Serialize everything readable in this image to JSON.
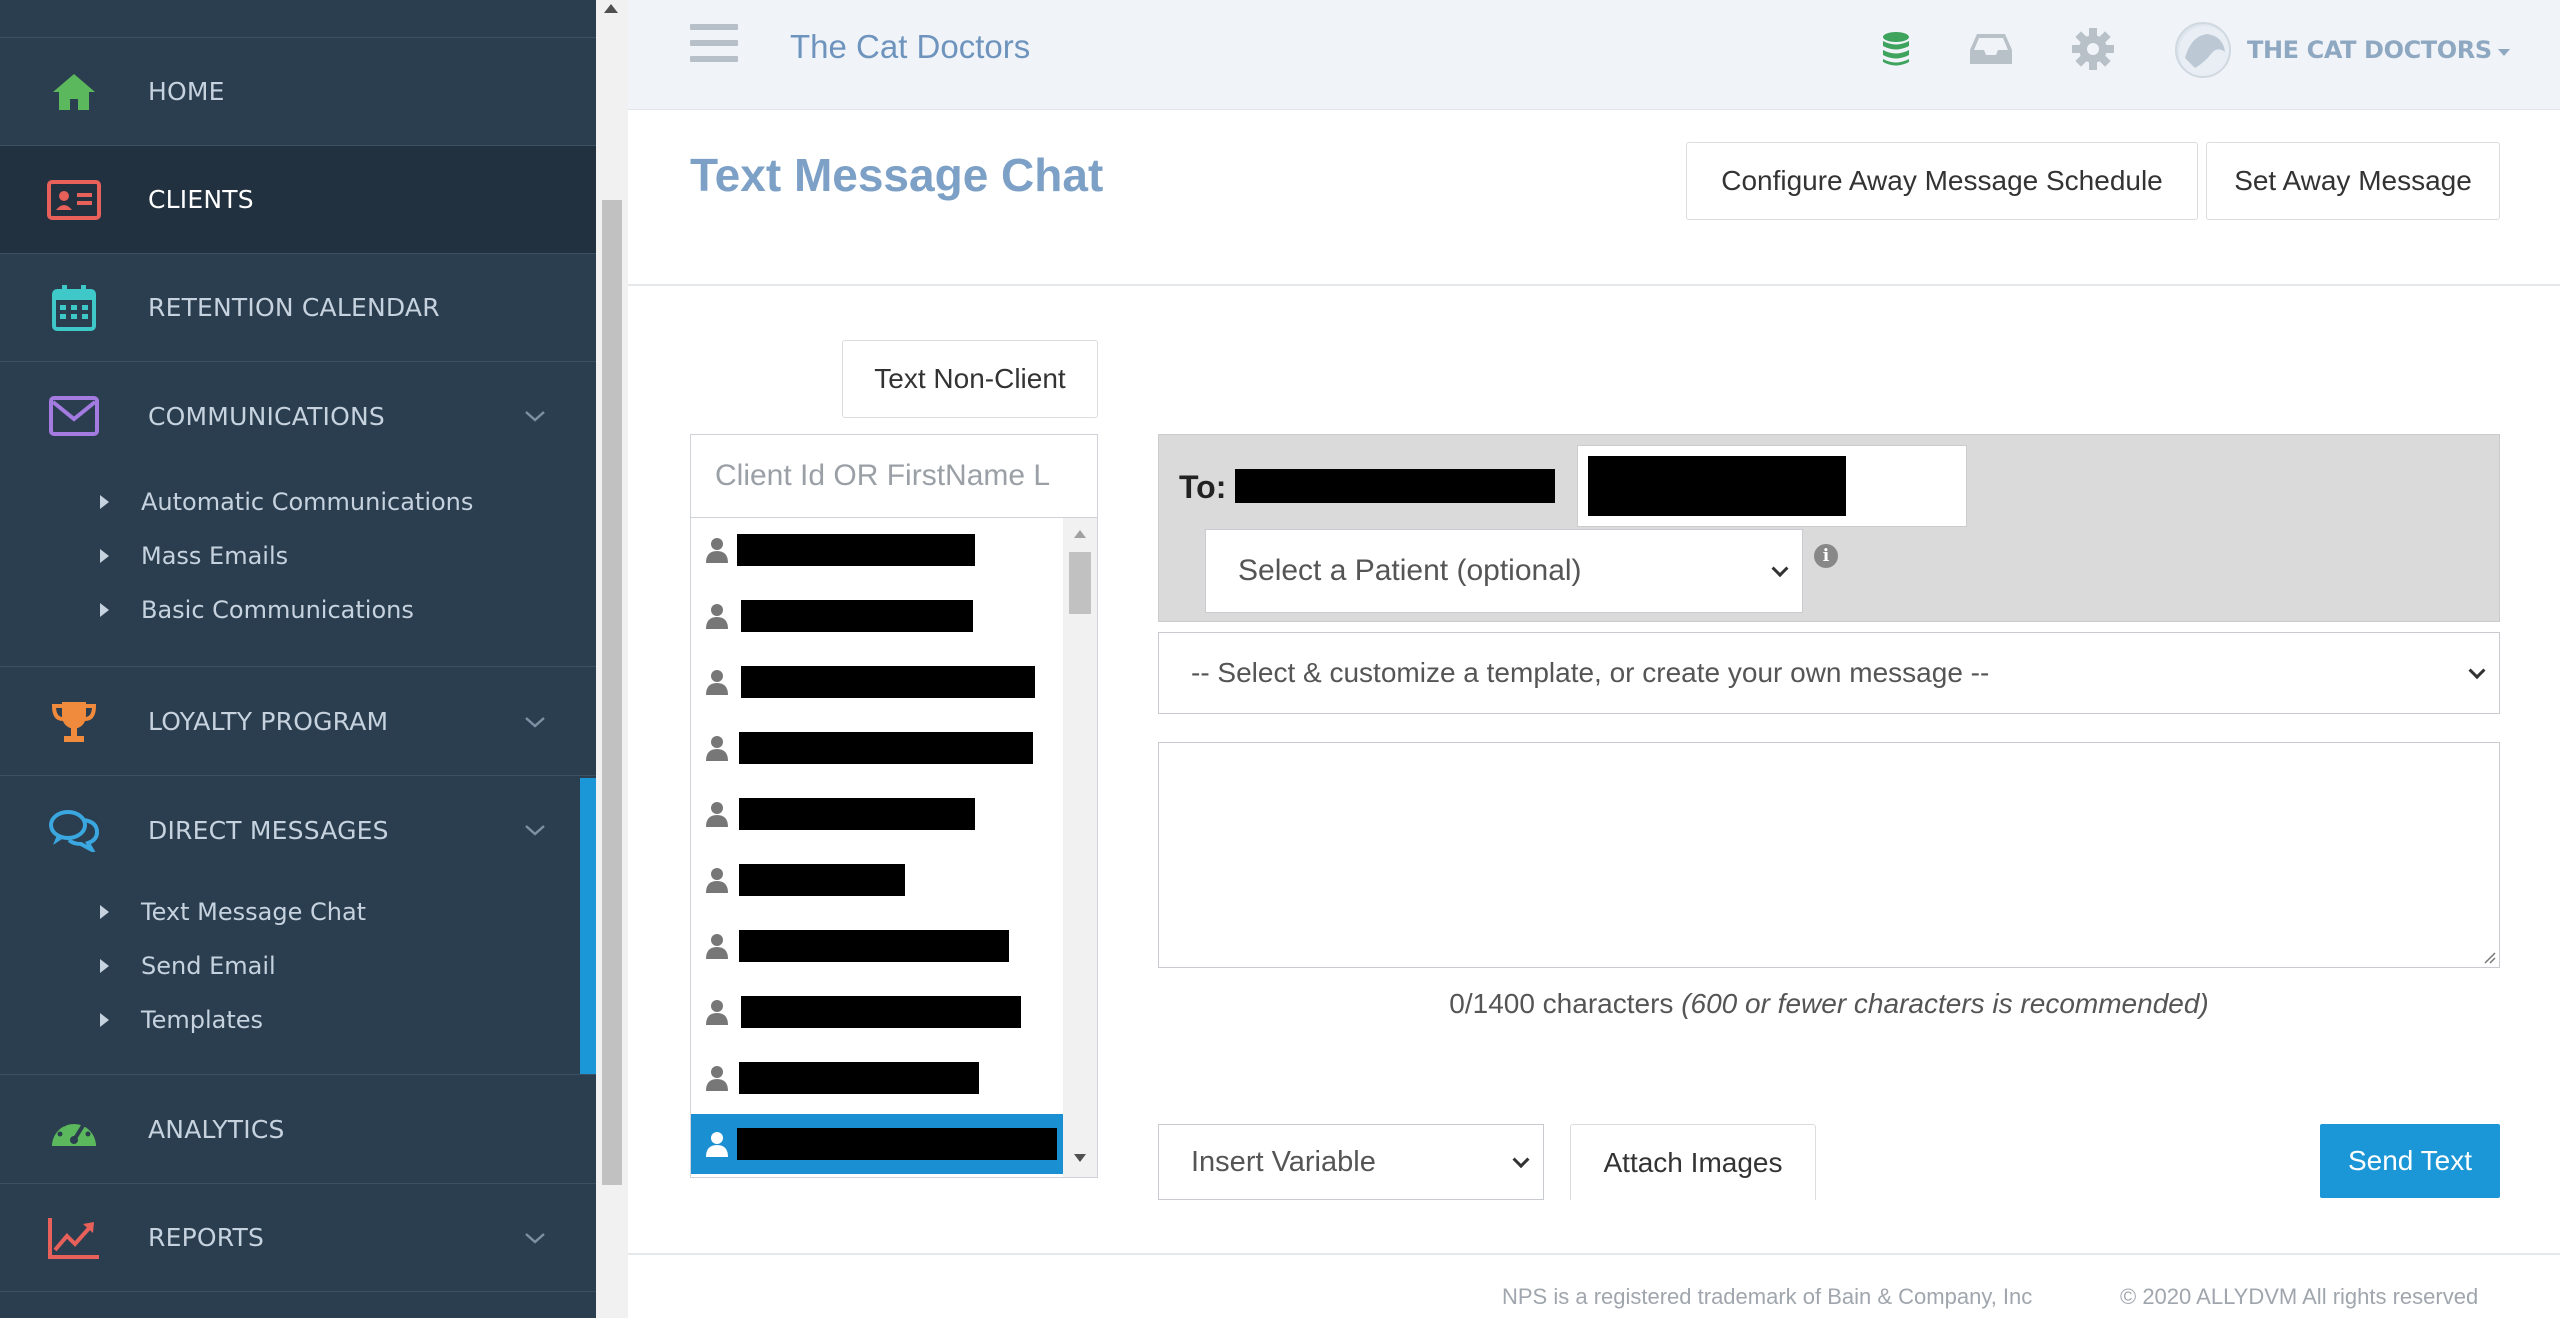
{
  "sidebar": {
    "items": [
      {
        "label": "HOME"
      },
      {
        "label": "CLIENTS"
      },
      {
        "label": "RETENTION CALENDAR"
      },
      {
        "label": "COMMUNICATIONS"
      },
      {
        "label": "LOYALTY PROGRAM"
      },
      {
        "label": "DIRECT MESSAGES"
      },
      {
        "label": "ANALYTICS"
      },
      {
        "label": "REPORTS"
      }
    ],
    "communications_sub": [
      "Automatic Communications",
      "Mass Emails",
      "Basic Communications"
    ],
    "direct_messages_sub": [
      "Text Message Chat",
      "Send Email",
      "Templates"
    ],
    "active_item": "CLIENTS",
    "expanded_section": "DIRECT MESSAGES"
  },
  "header": {
    "app_title": "The Cat Doctors",
    "account_label": "THE CAT DOCTORS",
    "icons": [
      "database-icon",
      "inbox-icon",
      "gear-icon"
    ]
  },
  "page": {
    "title": "Text Message Chat",
    "configure_away_label": "Configure Away Message Schedule",
    "set_away_label": "Set Away Message",
    "text_non_client_label": "Text Non-Client"
  },
  "clients": {
    "search_placeholder": "Client Id OR FirstName L",
    "row_count": 10,
    "selected_index": 9
  },
  "compose": {
    "to_label": "To:",
    "patient_select": "Select a Patient (optional)",
    "template_select": "-- Select & customize a template, or create your own message --",
    "message_value": "",
    "char_count": "0/1400 characters",
    "char_hint": "(600 or fewer characters is recommended)",
    "insert_variable": "Insert Variable",
    "attach_images": "Attach Images",
    "send_label": "Send Text"
  },
  "footer": {
    "nps": "NPS is a registered trademark of Bain & Company, Inc",
    "copyright": "© 2020 ALLYDVM All rights reserved"
  },
  "colors": {
    "sidebar_bg": "#2b3e50",
    "sidebar_active_bg": "#22313f",
    "accent_blue": "#1b96d6",
    "title_blue": "#7ca0c6",
    "home_icon": "#5cb85c",
    "clients_icon": "#e8605a",
    "calendar_icon": "#3ec8c8",
    "comms_icon": "#a47be0",
    "loyalty_icon": "#f08a3c",
    "dm_icon": "#3aa7e0",
    "analytics_icon": "#5cb85c",
    "reports_icon": "#e8605a"
  }
}
